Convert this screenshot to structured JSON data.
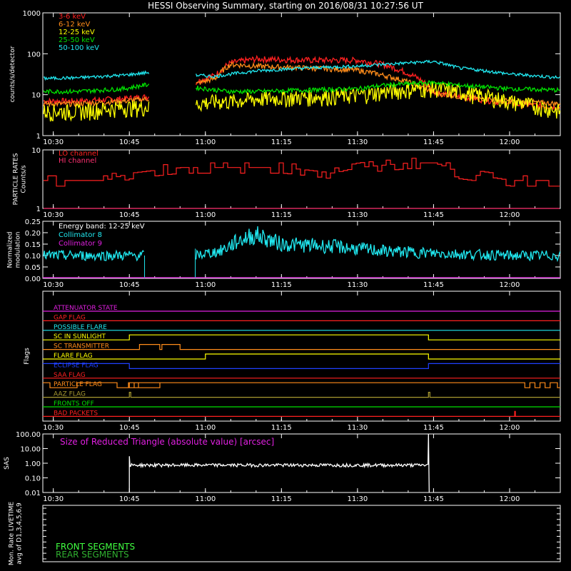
{
  "title": "HESSI Observing Summary, starting on 2016/08/31 10:27:56 UT",
  "time_ticks": [
    "10:30",
    "10:45",
    "11:00",
    "11:15",
    "11:30",
    "11:45",
    "12:00"
  ],
  "time_range": [
    "10:27:56",
    "12:10:00"
  ],
  "colors": {
    "bg": "#000000",
    "axis": "#ffffff",
    "red": "#ff2020",
    "orange": "#ff8c1a",
    "yellow": "#ffff00",
    "green": "#00e000",
    "cyan": "#20e8f0",
    "magenta": "#e020e0",
    "blue": "#2040ff",
    "olive": "#a89a30",
    "darkgreen": "#30b030",
    "lightgreen": "#40ff40"
  },
  "chart_data": [
    {
      "type": "line",
      "ylabel": "counts/s/detector",
      "yscale": "log",
      "ylim": [
        1,
        1000
      ],
      "y_ticks": [
        "1",
        "10",
        "100",
        "1000"
      ],
      "legend_placement": "top-left",
      "x": [
        "10:28",
        "10:35",
        "10:44",
        "10:49",
        "10:50",
        "10:57",
        "10:58",
        "11:02",
        "11:05",
        "11:10",
        "11:20",
        "11:30",
        "11:35",
        "11:45",
        "11:50",
        "12:00",
        "12:10"
      ],
      "series": [
        {
          "name": "3-6 keV",
          "color": "#ff2020",
          "values": [
            7,
            7,
            8,
            9,
            null,
            null,
            20,
            30,
            60,
            75,
            70,
            70,
            55,
            12,
            9,
            6,
            5
          ]
        },
        {
          "name": "6-12 keV",
          "color": "#ff8c1a",
          "values": [
            6,
            6,
            7,
            8,
            null,
            null,
            18,
            25,
            55,
            50,
            45,
            40,
            30,
            11,
            9,
            7,
            6
          ]
        },
        {
          "name": "12-25 keV",
          "color": "#ffff00",
          "values": [
            4,
            4,
            5,
            5,
            null,
            null,
            6,
            7,
            7,
            8,
            9,
            10,
            12,
            15,
            12,
            7,
            4
          ]
        },
        {
          "name": "25-50 keV",
          "color": "#00e000",
          "values": [
            12,
            12,
            14,
            18,
            null,
            null,
            15,
            13,
            12,
            12,
            13,
            14,
            17,
            20,
            17,
            14,
            13
          ]
        },
        {
          "name": "50-100 keV",
          "color": "#20e8f0",
          "values": [
            25,
            26,
            30,
            35,
            null,
            null,
            30,
            28,
            32,
            38,
            45,
            50,
            55,
            65,
            45,
            32,
            26
          ]
        }
      ]
    },
    {
      "type": "line",
      "ylabel": "PARTICLE RATES Counts/s",
      "yscale": "log",
      "ylim": [
        1,
        10
      ],
      "y_ticks": [
        "1",
        "10"
      ],
      "legend_placement": "top-left",
      "x": [
        "10:28",
        "10:40",
        "10:45",
        "10:55",
        "11:05",
        "11:15",
        "11:25",
        "11:30",
        "11:40",
        "11:45",
        "11:50",
        "12:00",
        "12:10"
      ],
      "series": [
        {
          "name": "LO channel",
          "color": "#ff2020",
          "values": [
            3,
            3,
            4,
            5,
            5,
            5,
            4,
            5,
            6,
            6,
            4,
            3,
            3
          ]
        },
        {
          "name": "HI channel",
          "color": "#ff3070",
          "values": [
            1,
            1,
            1,
            1,
            1,
            1,
            1,
            1,
            1,
            1,
            1,
            1,
            1
          ]
        }
      ]
    },
    {
      "type": "line",
      "ylabel": "Normalized modulation",
      "ylim": [
        0,
        0.25
      ],
      "y_ticks": [
        "0.00",
        "0.05",
        "0.10",
        "0.15",
        "0.20",
        "0.25"
      ],
      "annotation": "Energy band: 12-25 keV",
      "x": [
        "10:28",
        "10:40",
        "10:48",
        "10:49",
        "10:57",
        "10:58",
        "11:03",
        "11:07",
        "11:10",
        "11:15",
        "11:25",
        "11:35",
        "11:45",
        "12:00",
        "12:10"
      ],
      "series": [
        {
          "name": "Collimator 8",
          "color": "#20e8f0",
          "values": [
            0.1,
            0.1,
            0.1,
            null,
            null,
            0.1,
            0.12,
            0.17,
            0.19,
            0.15,
            0.14,
            0.12,
            0.11,
            0.1,
            0.1
          ]
        },
        {
          "name": "Collimator 9",
          "color": "#e020e0",
          "values": [
            0,
            0,
            0,
            0,
            0,
            0,
            0,
            0,
            0,
            0,
            0,
            0,
            0,
            0,
            0
          ]
        }
      ]
    },
    {
      "type": "line",
      "ylabel": "Flags",
      "flags": [
        {
          "name": "ATTENUATOR STATE",
          "color": "#e020e0"
        },
        {
          "name": "GAP FLAG",
          "color": "#ff2020"
        },
        {
          "name": "POSSIBLE FLARE",
          "color": "#20e8f0"
        },
        {
          "name": "SC IN SUNLIGHT",
          "color": "#ffff00"
        },
        {
          "name": "SC TRANSMITTER",
          "color": "#ff8c1a"
        },
        {
          "name": "FLARE FLAG",
          "color": "#ffff00"
        },
        {
          "name": "ECLIPSE FLAG",
          "color": "#2040ff"
        },
        {
          "name": "SAA FLAG",
          "color": "#ff2020"
        },
        {
          "name": "PARTICLE FLAG",
          "color": "#ff8c1a"
        },
        {
          "name": "AAZ FLAG",
          "color": "#a89a30"
        },
        {
          "name": "FRONTS OFF",
          "color": "#00e000"
        },
        {
          "name": "BAD PACKETS",
          "color": "#ff2020"
        }
      ]
    },
    {
      "type": "line",
      "ylabel": "SAS",
      "yscale": "log",
      "ylim": [
        0.01,
        100
      ],
      "y_ticks": [
        "0.01",
        "0.10",
        "1.00",
        "10.00",
        "100.00"
      ],
      "annotation": "Size of Reduced Triangle (absolute value) [arcsec]",
      "x": [
        "10:45",
        "11:00",
        "11:15",
        "11:30",
        "11:44"
      ],
      "series": [
        {
          "color": "#ffffff",
          "values": [
            0.8,
            0.7,
            0.7,
            0.7,
            0.8
          ]
        }
      ]
    },
    {
      "type": "line",
      "ylabel": "Mon. Rate LIVETIME avg of D1,3,4,5,6,9",
      "legend_placement": "bottom-left",
      "series": [
        {
          "name": "FRONT SEGMENTS",
          "color": "#40ff40",
          "values": []
        },
        {
          "name": "REAR SEGMENTS",
          "color": "#30b030",
          "values": []
        }
      ]
    }
  ]
}
